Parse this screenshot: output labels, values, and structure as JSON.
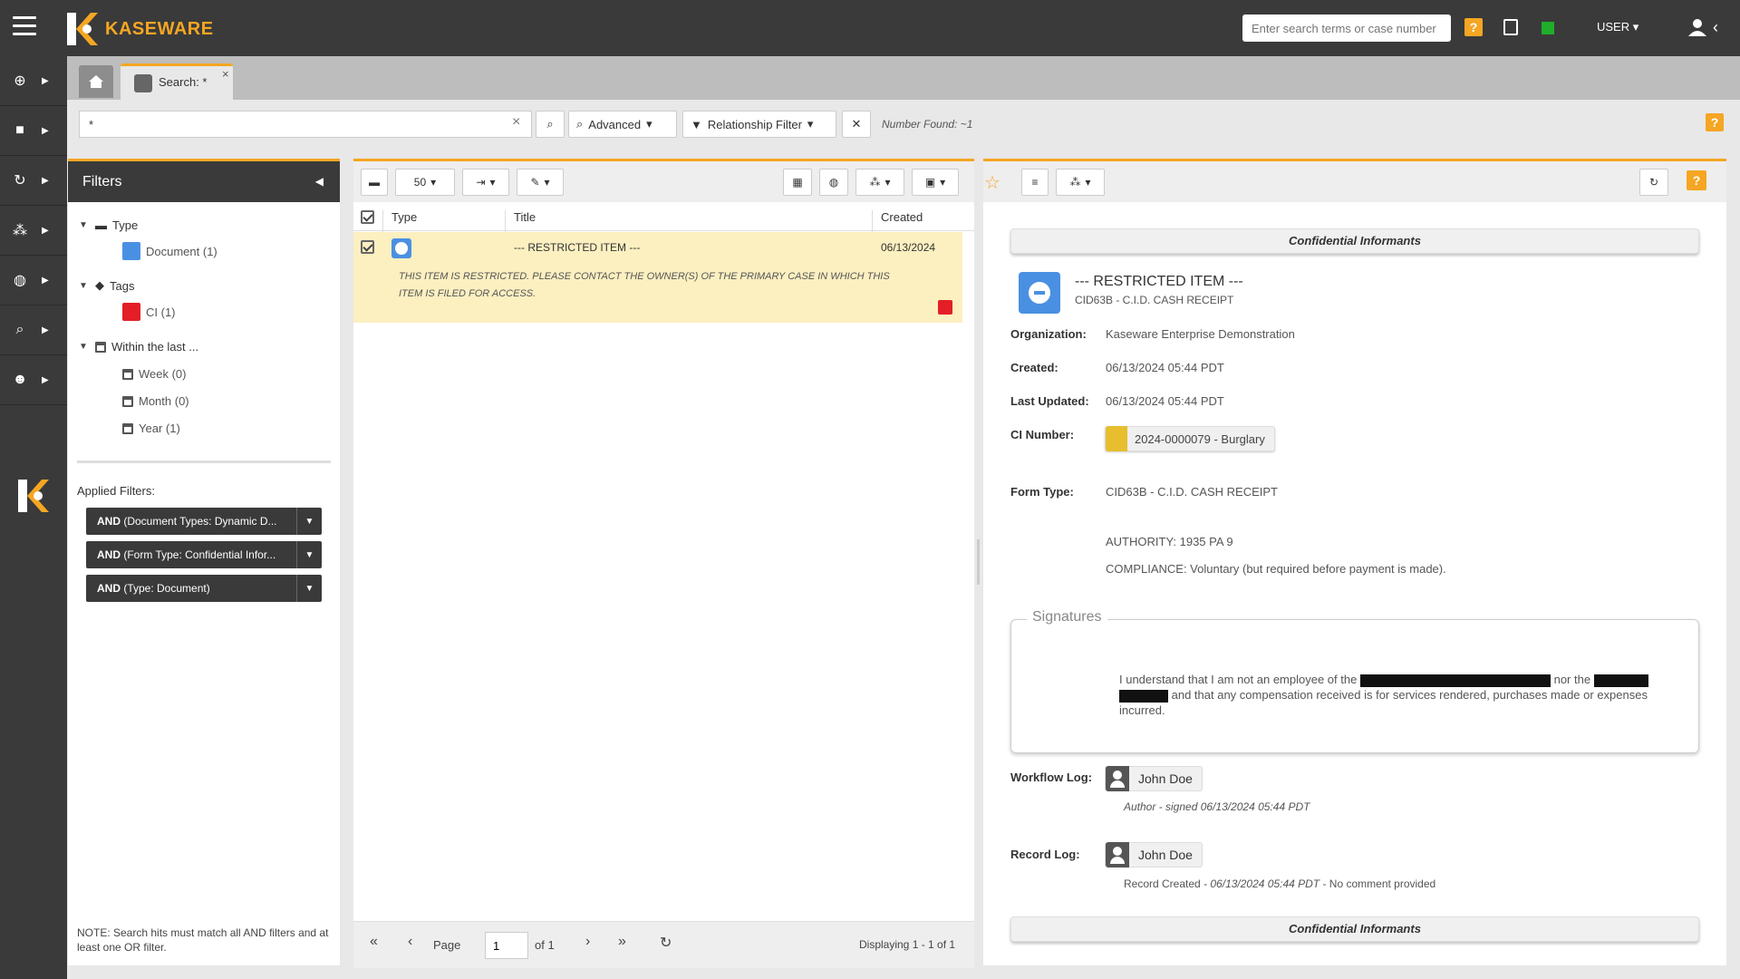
{
  "header": {
    "logo_text": "KASEWARE",
    "search_placeholder": "Enter search terms or case number",
    "help_label": "?",
    "user_label": "USER",
    "status_color": "#1fae2b",
    "accent_color": "#f5a623"
  },
  "rail": {
    "items": [
      {
        "icon": "plus-circle-icon"
      },
      {
        "icon": "briefcase-icon"
      },
      {
        "icon": "refresh-icon"
      },
      {
        "icon": "network-icon"
      },
      {
        "icon": "globe-icon"
      },
      {
        "icon": "search-icon"
      },
      {
        "icon": "users-icon"
      }
    ]
  },
  "tabs": {
    "home_icon": "home-icon",
    "search_tab_label": "Search: *"
  },
  "search": {
    "query": "*",
    "advanced_label": "Advanced",
    "relationship_filter_label": "Relationship Filter",
    "number_found": "Number Found: ~1",
    "help_label": "?"
  },
  "filters": {
    "title": "Filters",
    "type_label": "Type",
    "document_label": "Document (1)",
    "tags_label": "Tags",
    "ci_label": "CI (1)",
    "within_label": "Within the last ...",
    "week_label": "Week (0)",
    "month_label": "Month (0)",
    "year_label": "Year (1)",
    "applied_label": "Applied Filters:",
    "applied": [
      {
        "op": "AND",
        "text": " (Document Types: Dynamic D..."
      },
      {
        "op": "AND",
        "text": " (Form Type: Confidential Infor..."
      },
      {
        "op": "AND",
        "text": " (Type: Document)"
      }
    ],
    "note": "NOTE: Search hits must match all AND filters and at least one OR filter."
  },
  "results": {
    "page_size": "50",
    "columns": {
      "type": "Type",
      "title": "Title",
      "created": "Created"
    },
    "row": {
      "title": "--- RESTRICTED ITEM ---",
      "created": "06/13/2024",
      "message": "THIS ITEM IS RESTRICTED. PLEASE CONTACT THE OWNER(S) OF THE PRIMARY CASE IN WHICH THIS ITEM IS FILED FOR ACCESS."
    },
    "footer": {
      "page_label": "Page",
      "page_value": "1",
      "of_label": "of 1",
      "displaying": "Displaying 1 - 1 of 1"
    }
  },
  "detail": {
    "section_title": "Confidential Informants",
    "item_title": "--- RESTRICTED ITEM ---",
    "item_subtitle": "CID63B - C.I.D. CASH RECEIPT",
    "organization_label": "Organization:",
    "organization_value": "Kaseware Enterprise Demonstration",
    "created_label": "Created:",
    "created_value": "06/13/2024 05:44 PDT",
    "updated_label": "Last Updated:",
    "updated_value": "06/13/2024 05:44 PDT",
    "ci_number_label": "CI Number:",
    "ci_number_value": "2024-0000079 - Burglary",
    "form_type_label": "Form Type:",
    "form_type_value": "CID63B - C.I.D. CASH RECEIPT",
    "authority": "AUTHORITY: 1935 PA 9",
    "compliance": "COMPLIANCE: Voluntary (but required before payment is made).",
    "signatures_legend": "Signatures",
    "sig_text_1": "I understand that I am not an employee of the",
    "sig_text_2": "nor the",
    "sig_text_3": "and that any compensation received is for services rendered, purchases made or expenses incurred.",
    "workflow_label": "Workflow Log:",
    "workflow_person": "John Doe",
    "workflow_note": "Author - signed 06/13/2024 05:44 PDT",
    "record_label": "Record Log:",
    "record_person": "John Doe",
    "record_created": "Record Created",
    "record_date": " - 06/13/2024 05:44 PDT",
    "record_comment": " - No comment provided",
    "section_footer": "Confidential Informants"
  }
}
